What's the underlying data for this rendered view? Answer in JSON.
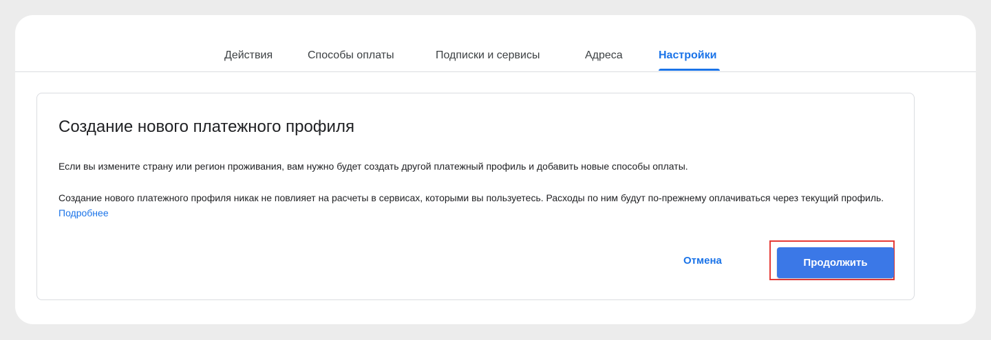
{
  "tabs": [
    {
      "label": "Действия"
    },
    {
      "label": "Способы оплаты"
    },
    {
      "label": "Подписки и сервисы"
    },
    {
      "label": "Адреса"
    },
    {
      "label": "Настройки",
      "active": true
    }
  ],
  "card": {
    "title": "Создание нового платежного профиля",
    "paragraph1": "Если вы измените страну или регион проживания, вам нужно будет создать другой платежный профиль и добавить новые способы оплаты.",
    "paragraph2": "Создание нового платежного профиля никак не повлияет на расчеты в сервисах, которыми вы пользуетесь. Расходы по ним будут по-прежнему оплачиваться через текущий профиль.",
    "learn_more_link": "Подробнее",
    "cancel_label": "Отмена",
    "continue_label": "Продолжить"
  },
  "colors": {
    "accent": "#1a73e8",
    "primary_button": "#3b78e7",
    "highlight": "#e53935",
    "background": "#ececec"
  }
}
